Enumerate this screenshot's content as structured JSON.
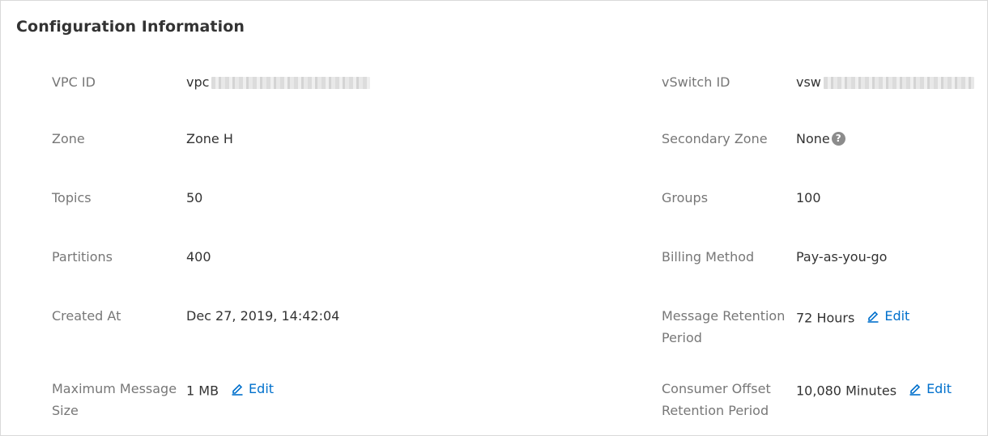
{
  "section": {
    "title": "Configuration Information"
  },
  "fields": {
    "vpc_id": {
      "label": "VPC ID",
      "value": "vpc"
    },
    "vswitch_id": {
      "label": "vSwitch ID",
      "value": "vsw"
    },
    "zone": {
      "label": "Zone",
      "value": "Zone H"
    },
    "secondary_zone": {
      "label": "Secondary Zone",
      "value": "None",
      "help_icon": "question-circle-icon",
      "help_glyph": "?"
    },
    "topics": {
      "label": "Topics",
      "value": "50"
    },
    "groups": {
      "label": "Groups",
      "value": "100"
    },
    "partitions": {
      "label": "Partitions",
      "value": "400"
    },
    "billing_method": {
      "label": "Billing Method",
      "value": "Pay-as-you-go"
    },
    "created_at": {
      "label": "Created At",
      "value": "Dec 27, 2019, 14:42:04"
    },
    "message_retention": {
      "label": "Message Retention Period",
      "value": "72 Hours",
      "action": "Edit"
    },
    "max_message_size": {
      "label": "Maximum Message Size",
      "value": "1 MB",
      "action": "Edit"
    },
    "consumer_offset_retention": {
      "label": "Consumer Offset Retention Period",
      "value": "10,080 Minutes",
      "action": "Edit"
    }
  },
  "colors": {
    "link": "#0070cc",
    "label": "#777777",
    "value": "#333333",
    "border": "#d9d9d9"
  }
}
